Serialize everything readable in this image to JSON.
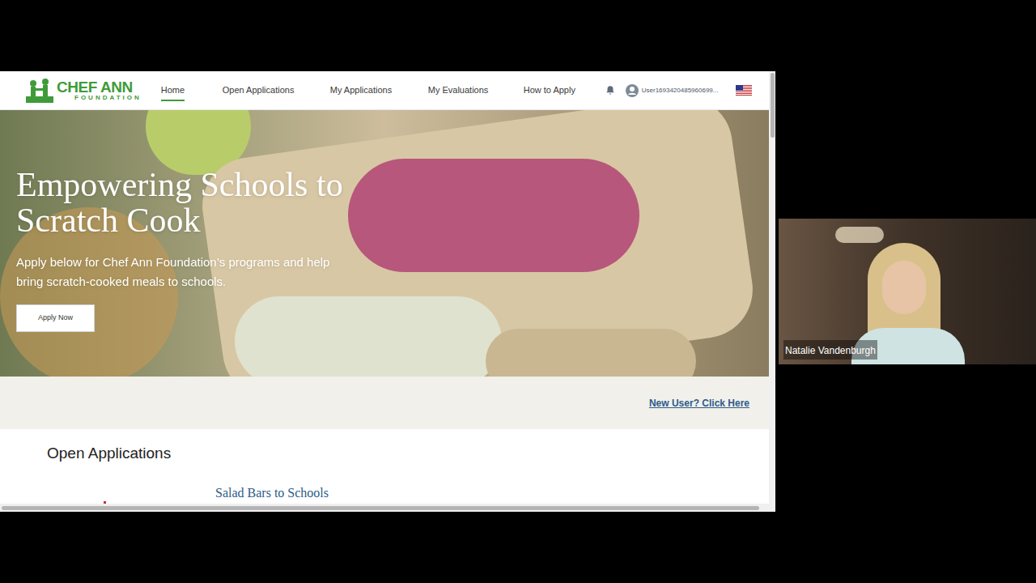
{
  "shared_screen": {
    "nav": {
      "logo": {
        "title": "CHEF ANN",
        "subtitle": "FOUNDATION"
      },
      "items": [
        {
          "label": "Home",
          "selected": true
        },
        {
          "label": "Open Applications",
          "selected": false
        },
        {
          "label": "My Applications",
          "selected": false
        },
        {
          "label": "My Evaluations",
          "selected": false
        },
        {
          "label": "How to Apply",
          "selected": false
        }
      ],
      "user": "User1693420485960699..."
    },
    "hero": {
      "title": "Empowering Schools to Scratch Cook",
      "text": "Apply below for Chef Ann Foundation’s programs and help bring scratch-cooked meals to schools.",
      "button": "Apply Now"
    },
    "new_user_link": "New User? Click Here",
    "section_title": "Open Applications",
    "program_title": "Salad Bars to Schools"
  },
  "participant": {
    "name": "Natalie Vandenburgh"
  }
}
